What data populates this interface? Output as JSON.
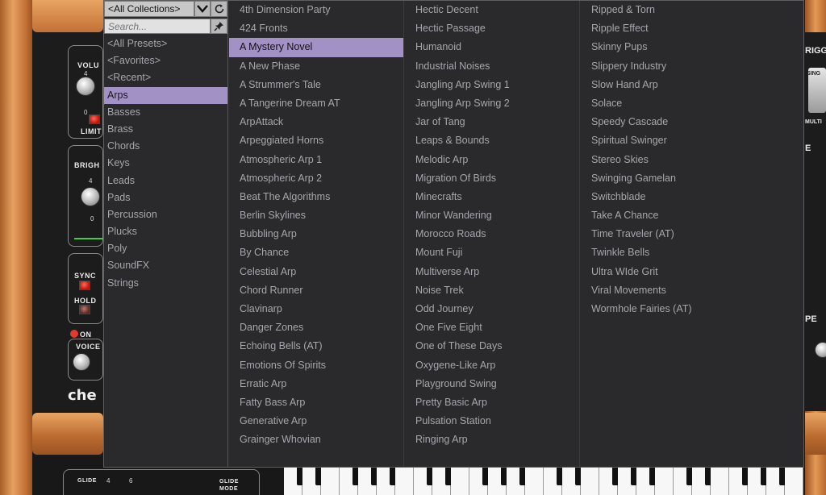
{
  "background": {
    "volume_label": "VOLU",
    "limit_label": "LIMIT",
    "bright_label": "BRIGH",
    "sync_label": "SYNC",
    "hold_label": "HOLD",
    "on_label": "ON",
    "voice_label": "VOICE",
    "brand_text": "che",
    "glide_label": "GLIDE",
    "glide_mode_label": "GLIDE MODE",
    "right_trigger_label": "RIGG",
    "right_single_label": "SING",
    "right_multi_label": "MULTI",
    "right_e_label": "E",
    "right_pe_label": "PE",
    "tick_4": "4",
    "tick_0": "0",
    "tick_6": "6"
  },
  "browser": {
    "collection": "<All Collections>",
    "search_placeholder": "Search...",
    "categories": [
      {
        "label": "<All Presets>",
        "selected": false
      },
      {
        "label": "<Favorites>",
        "selected": false
      },
      {
        "label": "<Recent>",
        "selected": false
      },
      {
        "label": "Arps",
        "selected": true
      },
      {
        "label": "Basses",
        "selected": false
      },
      {
        "label": "Brass",
        "selected": false
      },
      {
        "label": "Chords",
        "selected": false
      },
      {
        "label": "Keys",
        "selected": false
      },
      {
        "label": "Leads",
        "selected": false
      },
      {
        "label": "Pads",
        "selected": false
      },
      {
        "label": "Percussion",
        "selected": false
      },
      {
        "label": "Plucks",
        "selected": false
      },
      {
        "label": "Poly",
        "selected": false
      },
      {
        "label": "SoundFX",
        "selected": false
      },
      {
        "label": "Strings",
        "selected": false
      }
    ],
    "selected_preset": "A Mystery Novel",
    "preset_columns": [
      [
        "4th Dimension Party",
        "424 Fronts",
        "A Mystery Novel",
        "A New Phase",
        "A Strummer's Tale",
        "A Tangerine Dream AT",
        "ArpAttack",
        "Arpeggiated Horns",
        "Atmospheric Arp 1",
        "Atmospheric Arp 2",
        "Beat The Algorithms",
        "Berlin Skylines",
        "Bubbling Arp",
        "By Chance",
        "Celestial Arp",
        "Chord Runner",
        "Clavinarp",
        "Danger Zones",
        "Echoing Bells (AT)",
        "Emotions Of Spirits",
        "Erratic Arp",
        "Fatty Bass Arp",
        "Generative Arp",
        "Grainger Whovian"
      ],
      [
        "Hectic Decent",
        "Hectic Passage",
        "Humanoid",
        "Industrial Noises",
        "Jangling Arp Swing 1",
        "Jangling Arp Swing 2",
        "Jar of Tang",
        "Leaps & Bounds",
        "Melodic Arp",
        "Migration Of Birds",
        "Minecrafts",
        "Minor Wandering",
        "Morocco Roads",
        "Mount Fuji",
        "Multiverse Arp",
        "Noise Trek",
        "Odd Journey",
        "One Five Eight",
        "One of These Days",
        "Oxygene-Like Arp",
        "Playground Swing",
        "Pretty Basic Arp",
        "Pulsation Station",
        "Ringing Arp"
      ],
      [
        "Ripped & Torn",
        "Ripple Effect",
        "Skinny Pups",
        "Slippery Industry",
        "Slow Hand Arp",
        "Solace",
        "Speedy Cascade",
        "Spiritual Swinger",
        "Stereo Skies",
        "Swinging Gamelan",
        "Switchblade",
        "Take A Chance",
        "Time Traveler (AT)",
        "Twinkle Bells",
        "Ultra WIde Grit",
        "Viral Movements",
        "Wormhole Fairies (AT)"
      ]
    ]
  },
  "colors": {
    "selection": "#a291c4",
    "list_text": "#a6a6ad",
    "popup_bg": "#2a2a2c"
  }
}
